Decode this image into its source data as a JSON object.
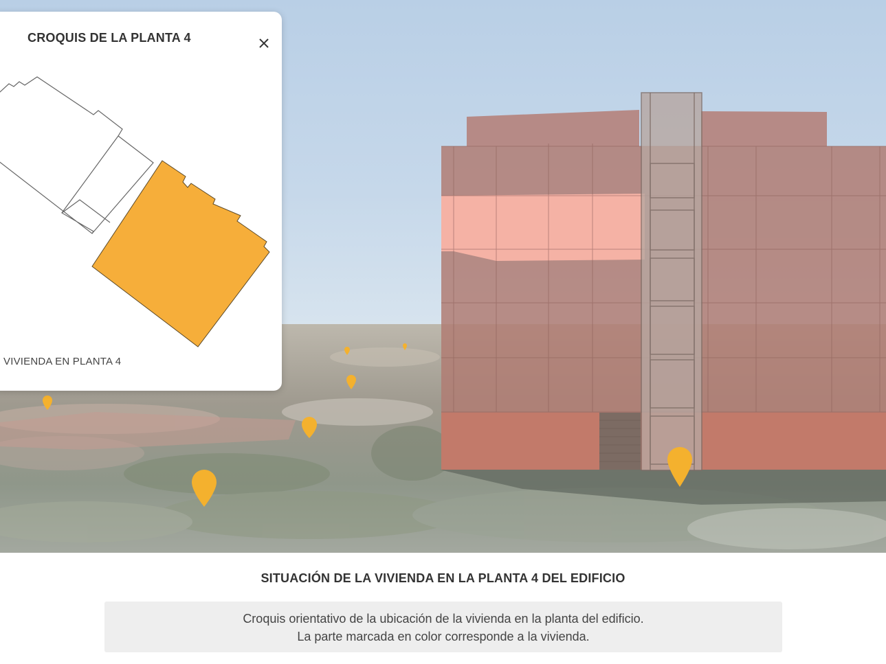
{
  "popup": {
    "title": "CROQUIS DE LA PLANTA 4",
    "close_icon": "close-icon",
    "caption": "VIVIENDA EN PLANTA 4"
  },
  "footer": {
    "title": "SITUACIÓN DE LA VIVIENDA EN LA PLANTA 4 DEL EDIFICIO",
    "note_lines": [
      "Croquis orientativo de la ubicación de la vivienda en la planta del edificio.",
      "La parte marcada en color corresponde a la vivienda."
    ]
  },
  "colors": {
    "highlight_unit": "#f6ae3a",
    "highlight_floor": "#f7b3a8",
    "building": "#b88a82",
    "marker": "#f4b12e"
  },
  "icons": [
    "close-icon",
    "map-marker-icon"
  ]
}
